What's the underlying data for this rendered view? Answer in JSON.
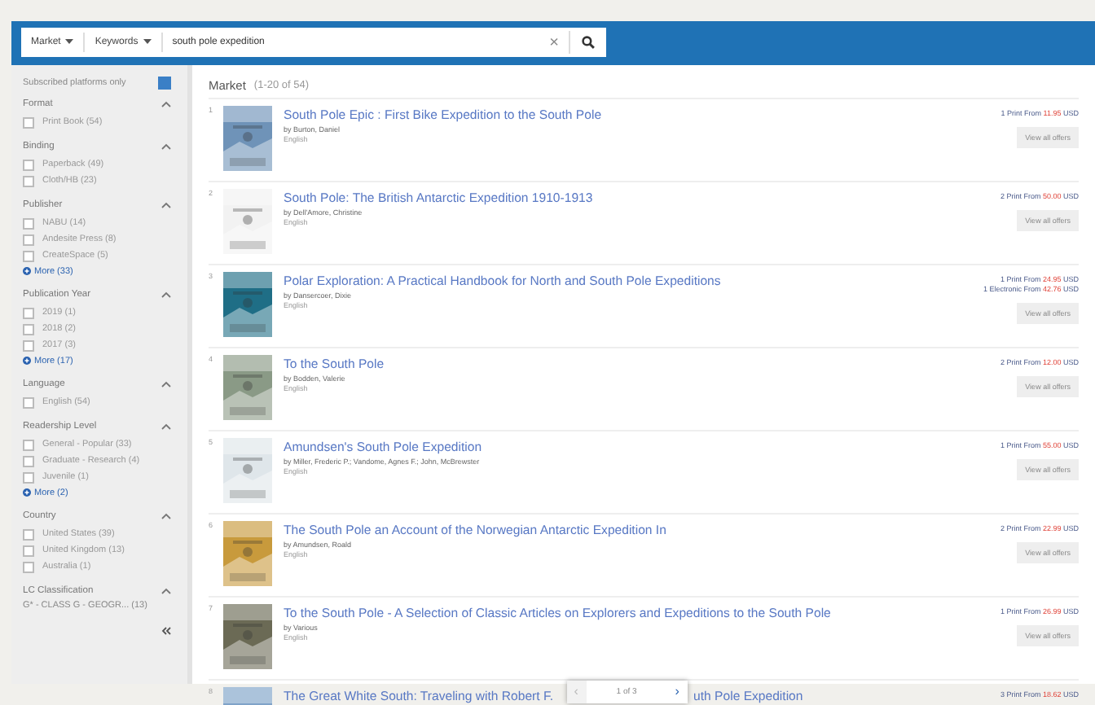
{
  "search": {
    "scope": "Market",
    "field": "Keywords",
    "value": "south pole expedition",
    "clear": "×"
  },
  "sidebar": {
    "subscribed": {
      "label": "Subscribed platforms only",
      "checked": true
    },
    "facets": [
      {
        "title": "Format",
        "expanded": true,
        "options": [
          {
            "label": "Print Book (54)",
            "checked": false
          }
        ]
      },
      {
        "title": "Binding",
        "expanded": true,
        "options": [
          {
            "label": "Paperback (49)",
            "checked": false
          },
          {
            "label": "Cloth/HB (23)",
            "checked": false
          }
        ]
      },
      {
        "title": "Publisher",
        "expanded": true,
        "options": [
          {
            "label": "NABU (14)",
            "checked": false
          },
          {
            "label": "Andesite Press (8)",
            "checked": false
          },
          {
            "label": "CreateSpace (5)",
            "checked": false
          }
        ],
        "more": "More (33)"
      },
      {
        "title": "Publication Year",
        "expanded": true,
        "options": [
          {
            "label": "2019 (1)",
            "checked": false
          },
          {
            "label": "2018 (2)",
            "checked": false
          },
          {
            "label": "2017 (3)",
            "checked": false
          }
        ],
        "more": "More (17)"
      },
      {
        "title": "Language",
        "expanded": true,
        "options": [
          {
            "label": "English (54)",
            "checked": false
          }
        ]
      },
      {
        "title": "Readership Level",
        "expanded": true,
        "options": [
          {
            "label": "General - Popular (33)",
            "checked": false
          },
          {
            "label": "Graduate - Research (4)",
            "checked": false
          },
          {
            "label": "Juvenile (1)",
            "checked": false
          }
        ],
        "more": "More (2)"
      },
      {
        "title": "Country",
        "expanded": true,
        "options": [
          {
            "label": "United States (39)",
            "checked": false
          },
          {
            "label": "United Kingdom (13)",
            "checked": false
          },
          {
            "label": "Australia (1)",
            "checked": false
          }
        ]
      },
      {
        "title": "LC Classification",
        "expanded": true,
        "values": [
          "G* - CLASS G - GEOGR... (13)"
        ]
      }
    ]
  },
  "results": {
    "heading": "Market",
    "count": "(1-20 of 54)",
    "items": [
      {
        "number": "1",
        "title": "South Pole Epic : First Bike Expedition to the South Pole",
        "author": "by Burton, Daniel",
        "language": "English",
        "offers": [
          {
            "text": "1 Print From",
            "price": "11.95",
            "currency": "USD"
          }
        ],
        "button": "View all offers"
      },
      {
        "number": "2",
        "title": "South Pole: The British Antarctic Expedition 1910-1913",
        "author": "by Dell'Amore, Christine",
        "language": "English",
        "offers": [
          {
            "text": "2 Print From",
            "price": "50.00",
            "currency": "USD"
          }
        ],
        "button": "View all offers"
      },
      {
        "number": "3",
        "title": "Polar Exploration: A Practical Handbook for North and South Pole Expeditions",
        "author": "by Dansercoer, Dixie",
        "language": "English",
        "offers": [
          {
            "text": "1 Print From",
            "price": "24.95",
            "currency": "USD"
          },
          {
            "text": "1 Electronic From",
            "price": "42.76",
            "currency": "USD"
          }
        ],
        "button": "View all offers"
      },
      {
        "number": "4",
        "title": "To the South Pole",
        "author": "by Bodden, Valerie",
        "language": "English",
        "offers": [
          {
            "text": "2 Print From",
            "price": "12.00",
            "currency": "USD"
          }
        ],
        "button": "View all offers"
      },
      {
        "number": "5",
        "title": "Amundsen's South Pole Expedition",
        "author": "by Miller, Frederic P.; Vandome, Agnes F.; John, McBrewster",
        "language": "English",
        "offers": [
          {
            "text": "1 Print From",
            "price": "55.00",
            "currency": "USD"
          }
        ],
        "button": "View all offers"
      },
      {
        "number": "6",
        "title": "The South Pole an Account of the Norwegian Antarctic Expedition In",
        "author": "by Amundsen, Roald",
        "language": "English",
        "offers": [
          {
            "text": "2 Print From",
            "price": "22.99",
            "currency": "USD"
          }
        ],
        "button": "View all offers"
      },
      {
        "number": "7",
        "title": "To the South Pole - A Selection of Classic Articles on Explorers and Expeditions to the South Pole",
        "author": "by Various",
        "language": "English",
        "offers": [
          {
            "text": "1 Print From",
            "price": "26.99",
            "currency": "USD"
          }
        ],
        "button": "View all offers"
      },
      {
        "number": "8",
        "title_parts": [
          "The Great White South: Traveling with Robert F.",
          "uth Pole Expedition"
        ],
        "offers": [
          {
            "text": "3 Print From",
            "price": "18.62",
            "currency": "USD"
          }
        ]
      }
    ]
  },
  "pager": {
    "label": "1 of 3",
    "prev": "‹",
    "next": "›"
  }
}
